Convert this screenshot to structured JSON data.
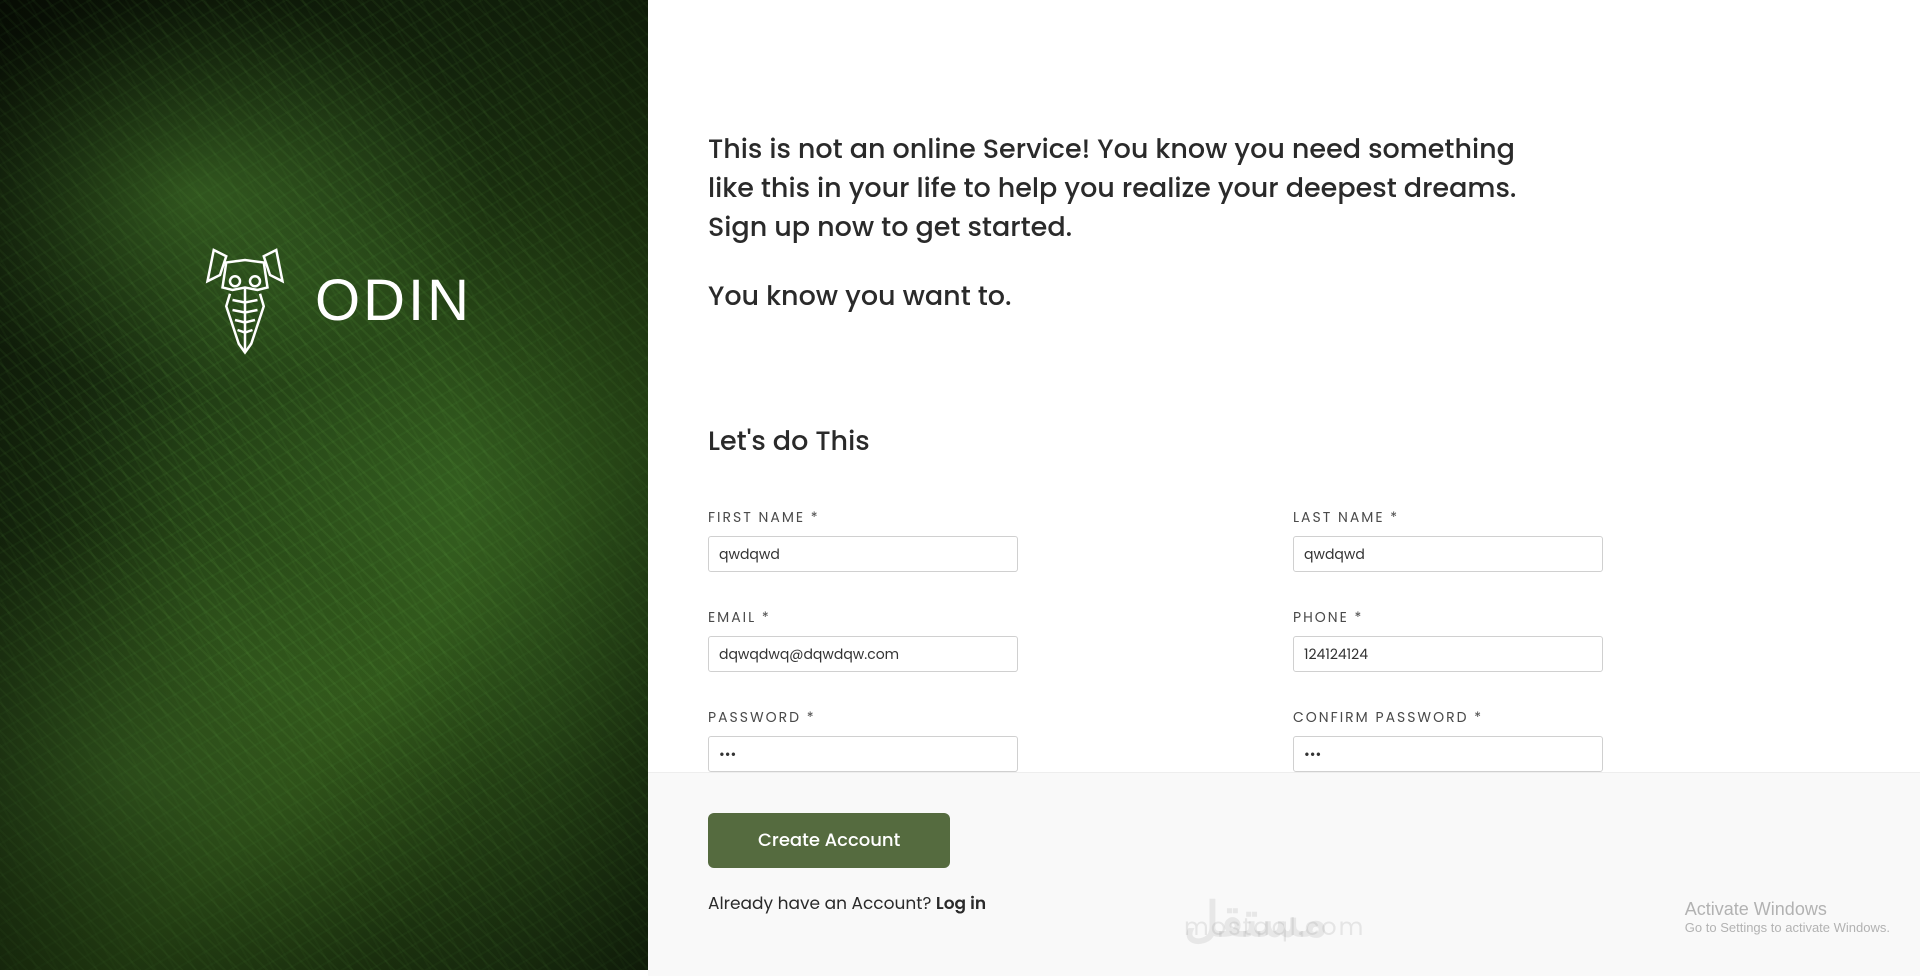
{
  "brand": {
    "name": "ODIN"
  },
  "intro": {
    "paragraph": "This is not an online Service! You know you need something like this in your life to help you realize your deepest dreams. Sign up now to get started.",
    "subline": "You know you want to."
  },
  "form": {
    "title": "Let's do This",
    "fields": {
      "first_name": {
        "label": "FIRST NAME *",
        "value": "qwdqwd"
      },
      "last_name": {
        "label": "LAST NAME *",
        "value": "qwdqwd"
      },
      "email": {
        "label": "EMAIL *",
        "value": "dqwqdwq@dqwdqw.com"
      },
      "phone": {
        "label": "PHONE *",
        "value": "124124124"
      },
      "password": {
        "label": "PASSWORD *",
        "value": "•••"
      },
      "confirm_password": {
        "label": "CONFIRM PASSWORD *",
        "value": "•••"
      }
    }
  },
  "actions": {
    "create_account": "Create Account",
    "login_prompt": "Already have an Account? ",
    "login_link": "Log in"
  },
  "watermark": {
    "main": "مستقل",
    "sub": "mostaql.com"
  },
  "os_overlay": {
    "title": "Activate Windows",
    "subtitle": "Go to Settings to activate Windows."
  }
}
